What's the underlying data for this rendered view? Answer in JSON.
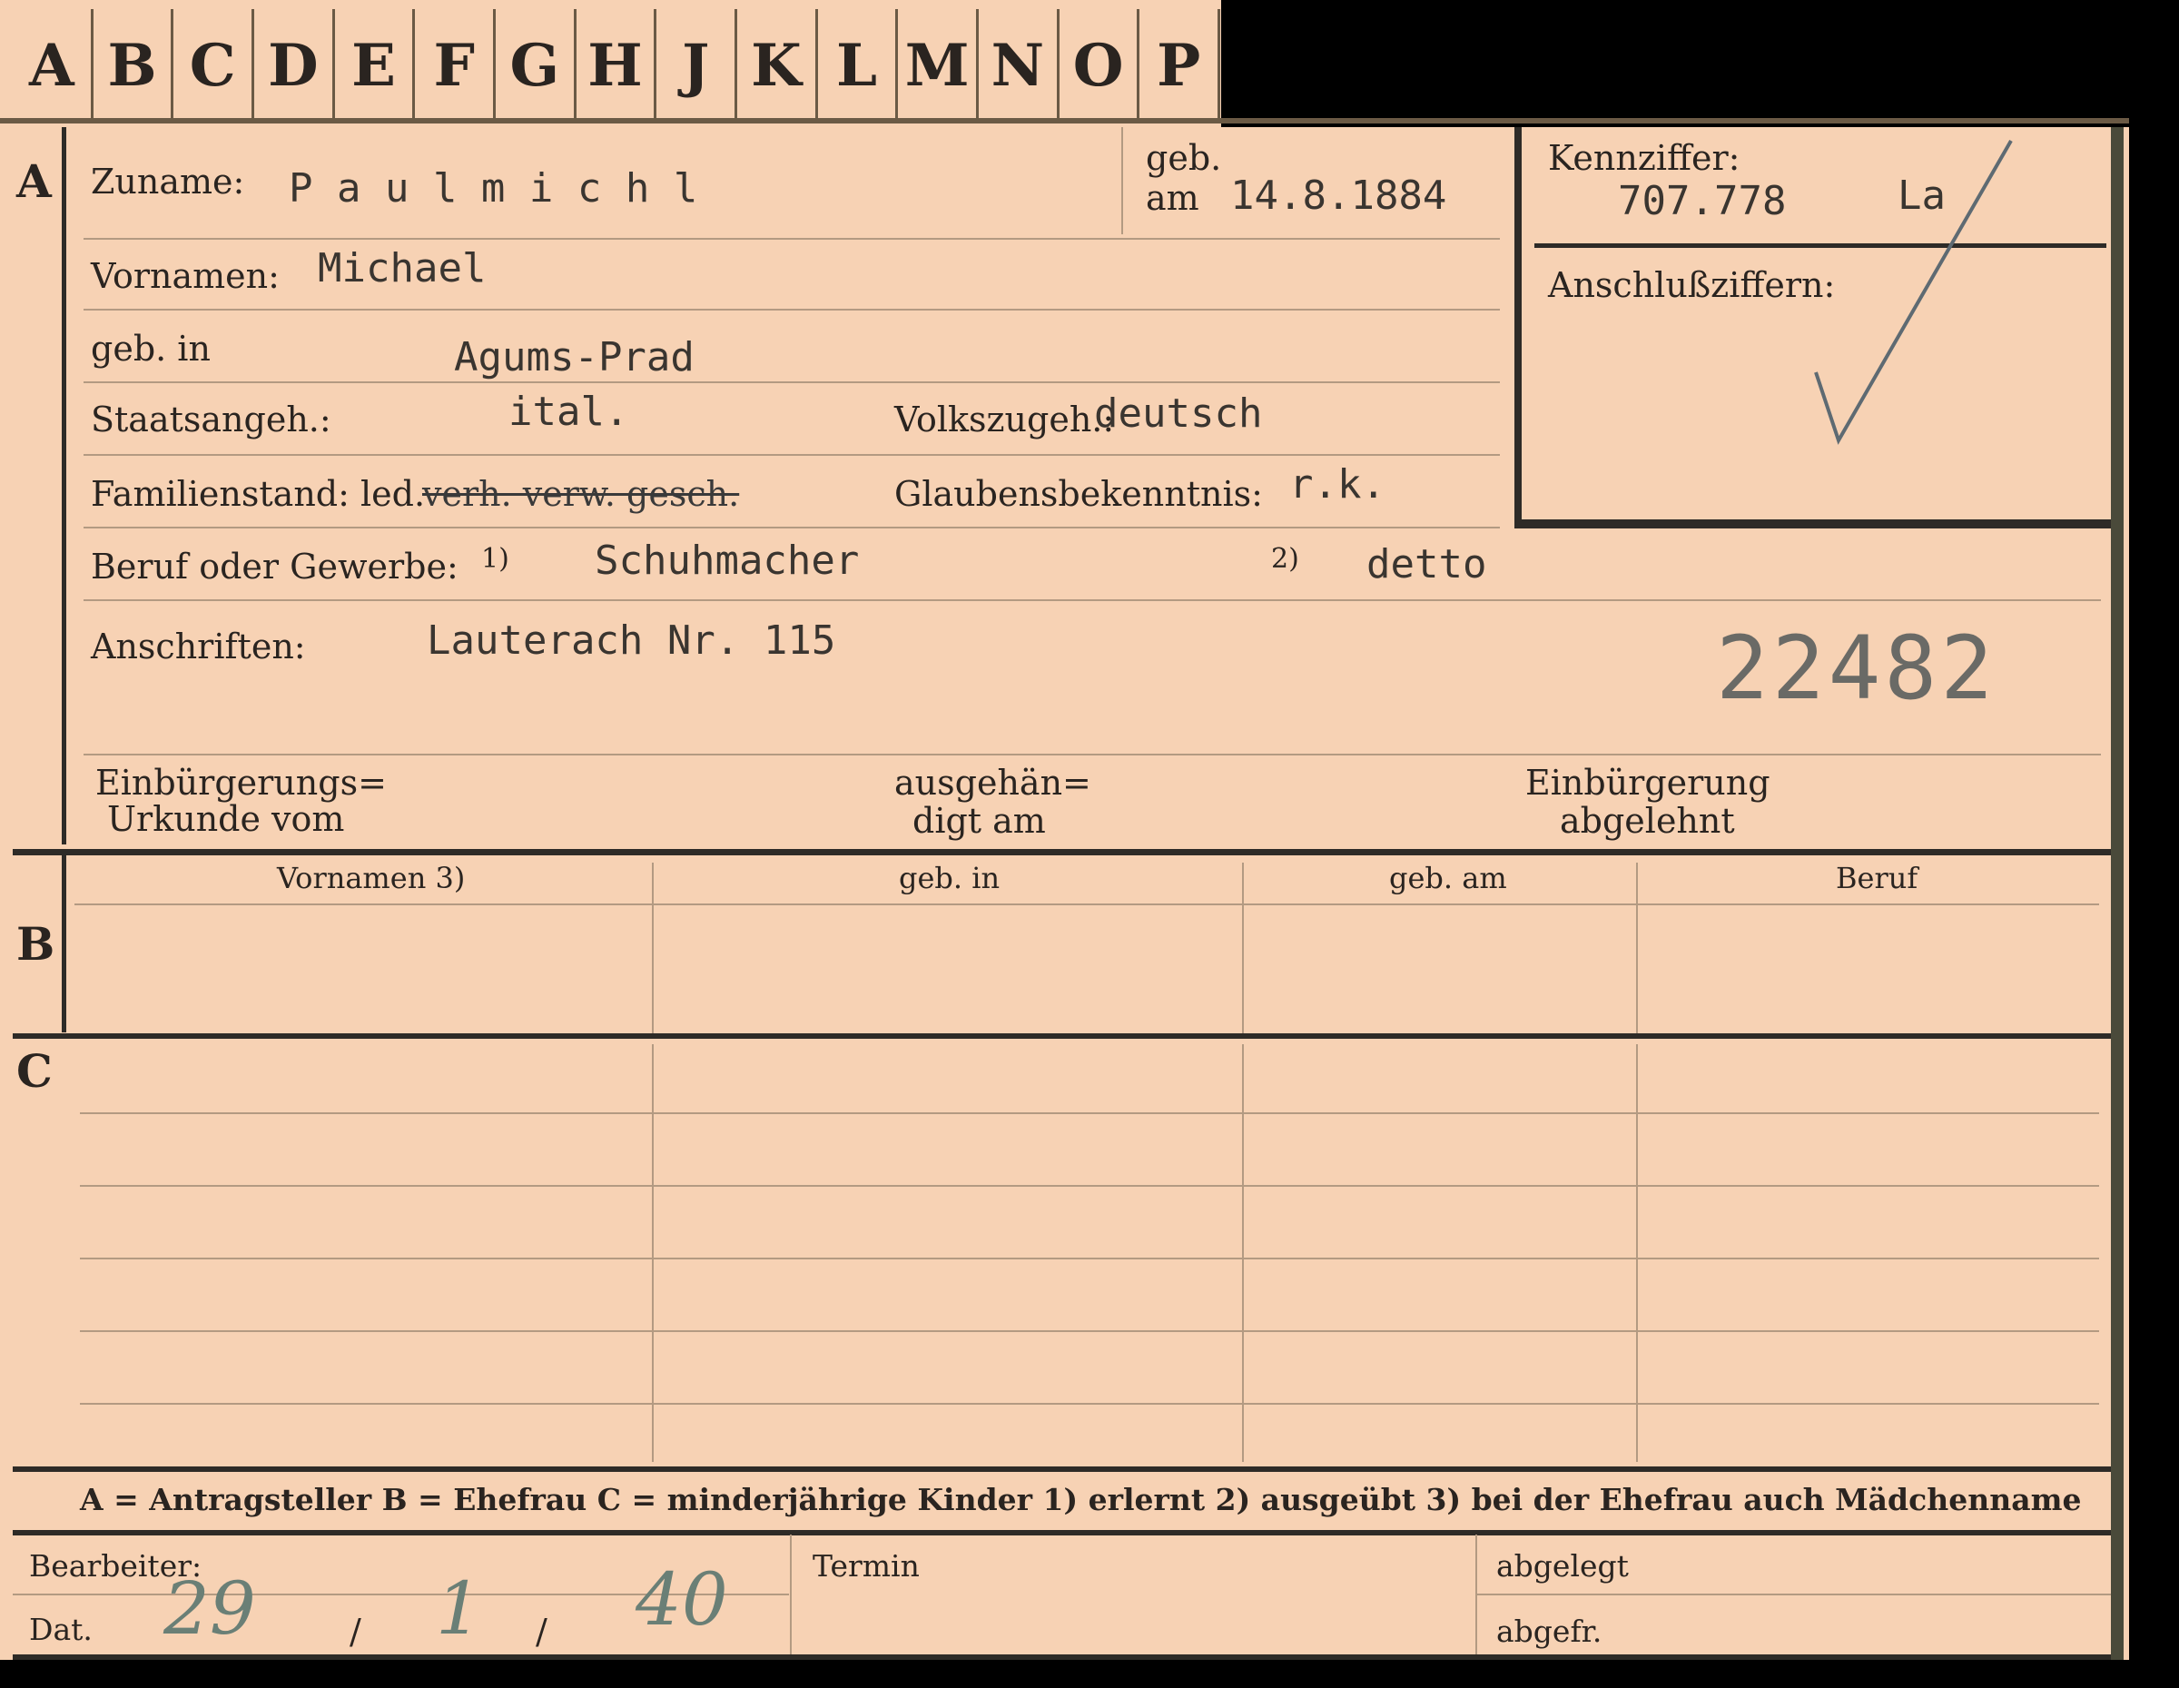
{
  "tabs": [
    "A",
    "B",
    "C",
    "D",
    "E",
    "F",
    "G",
    "H",
    "J",
    "K",
    "L",
    "M",
    "N",
    "O",
    "P"
  ],
  "section_a": {
    "letter": "A",
    "zuname_label": "Zuname:",
    "zuname_value": "P a u l m i c h l",
    "geb_am_label_top": "geb.",
    "geb_am_label_bottom": "am",
    "geb_am_value": "14.8.1884",
    "vornamen_label": "Vornamen:",
    "vornamen_value": "Michael",
    "geb_in_label": "geb. in",
    "geb_in_value": "Agums-Prad",
    "staatsangeh_label": "Staatsangeh.:",
    "staatsangeh_value": "ital.",
    "volkszugeh_label": "Volkszugeh.:",
    "volkszugeh_value": "deutsch",
    "familienstand_label": "Familienstand: led.",
    "familienstand_struck": "verh. verw. gesch.",
    "glaubens_label": "Glaubensbekenntnis:",
    "glaubens_value": "r.k.",
    "beruf_label": "Beruf oder Gewerbe:",
    "beruf_note1": "1)",
    "beruf_value1": "Schuhmacher",
    "beruf_note2": "2)",
    "beruf_value2": "detto",
    "anschriften_label": "Anschriften:",
    "anschriften_value": "Lauterach Nr. 115",
    "stamp_number": "22482",
    "einb_urkunde_label_1": "Einbürgerungs=",
    "einb_urkunde_label_2": "Urkunde vom",
    "ausgeh_label_1": "ausgehän=",
    "ausgeh_label_2": "digt am",
    "einb_abgelehnt_1": "Einbürgerung",
    "einb_abgelehnt_2": "abgelehnt"
  },
  "kennziffer": {
    "label": "Kennziffer:",
    "value": "707.778",
    "suffix": "La",
    "anschluss_label": "Anschlußziffern:"
  },
  "section_b": {
    "letter": "B",
    "headers": [
      "Vornamen 3)",
      "geb. in",
      "geb. am",
      "Beruf"
    ]
  },
  "section_c": {
    "letter": "C"
  },
  "legend": "A = Antragsteller   B = Ehefrau   C = minderjährige Kinder   1) erlernt   2) ausgeübt   3) bei der Ehefrau auch Mädchenname",
  "footer": {
    "bearbeiter_label": "Bearbeiter:",
    "dat_label": "Dat.",
    "dat_day": "29",
    "dat_sep1": "/",
    "dat_month": "1",
    "dat_sep2": "/",
    "dat_year": "40",
    "termin_label": "Termin",
    "abgelegt_label": "abgelegt",
    "abgefr_label": "abgefr."
  }
}
